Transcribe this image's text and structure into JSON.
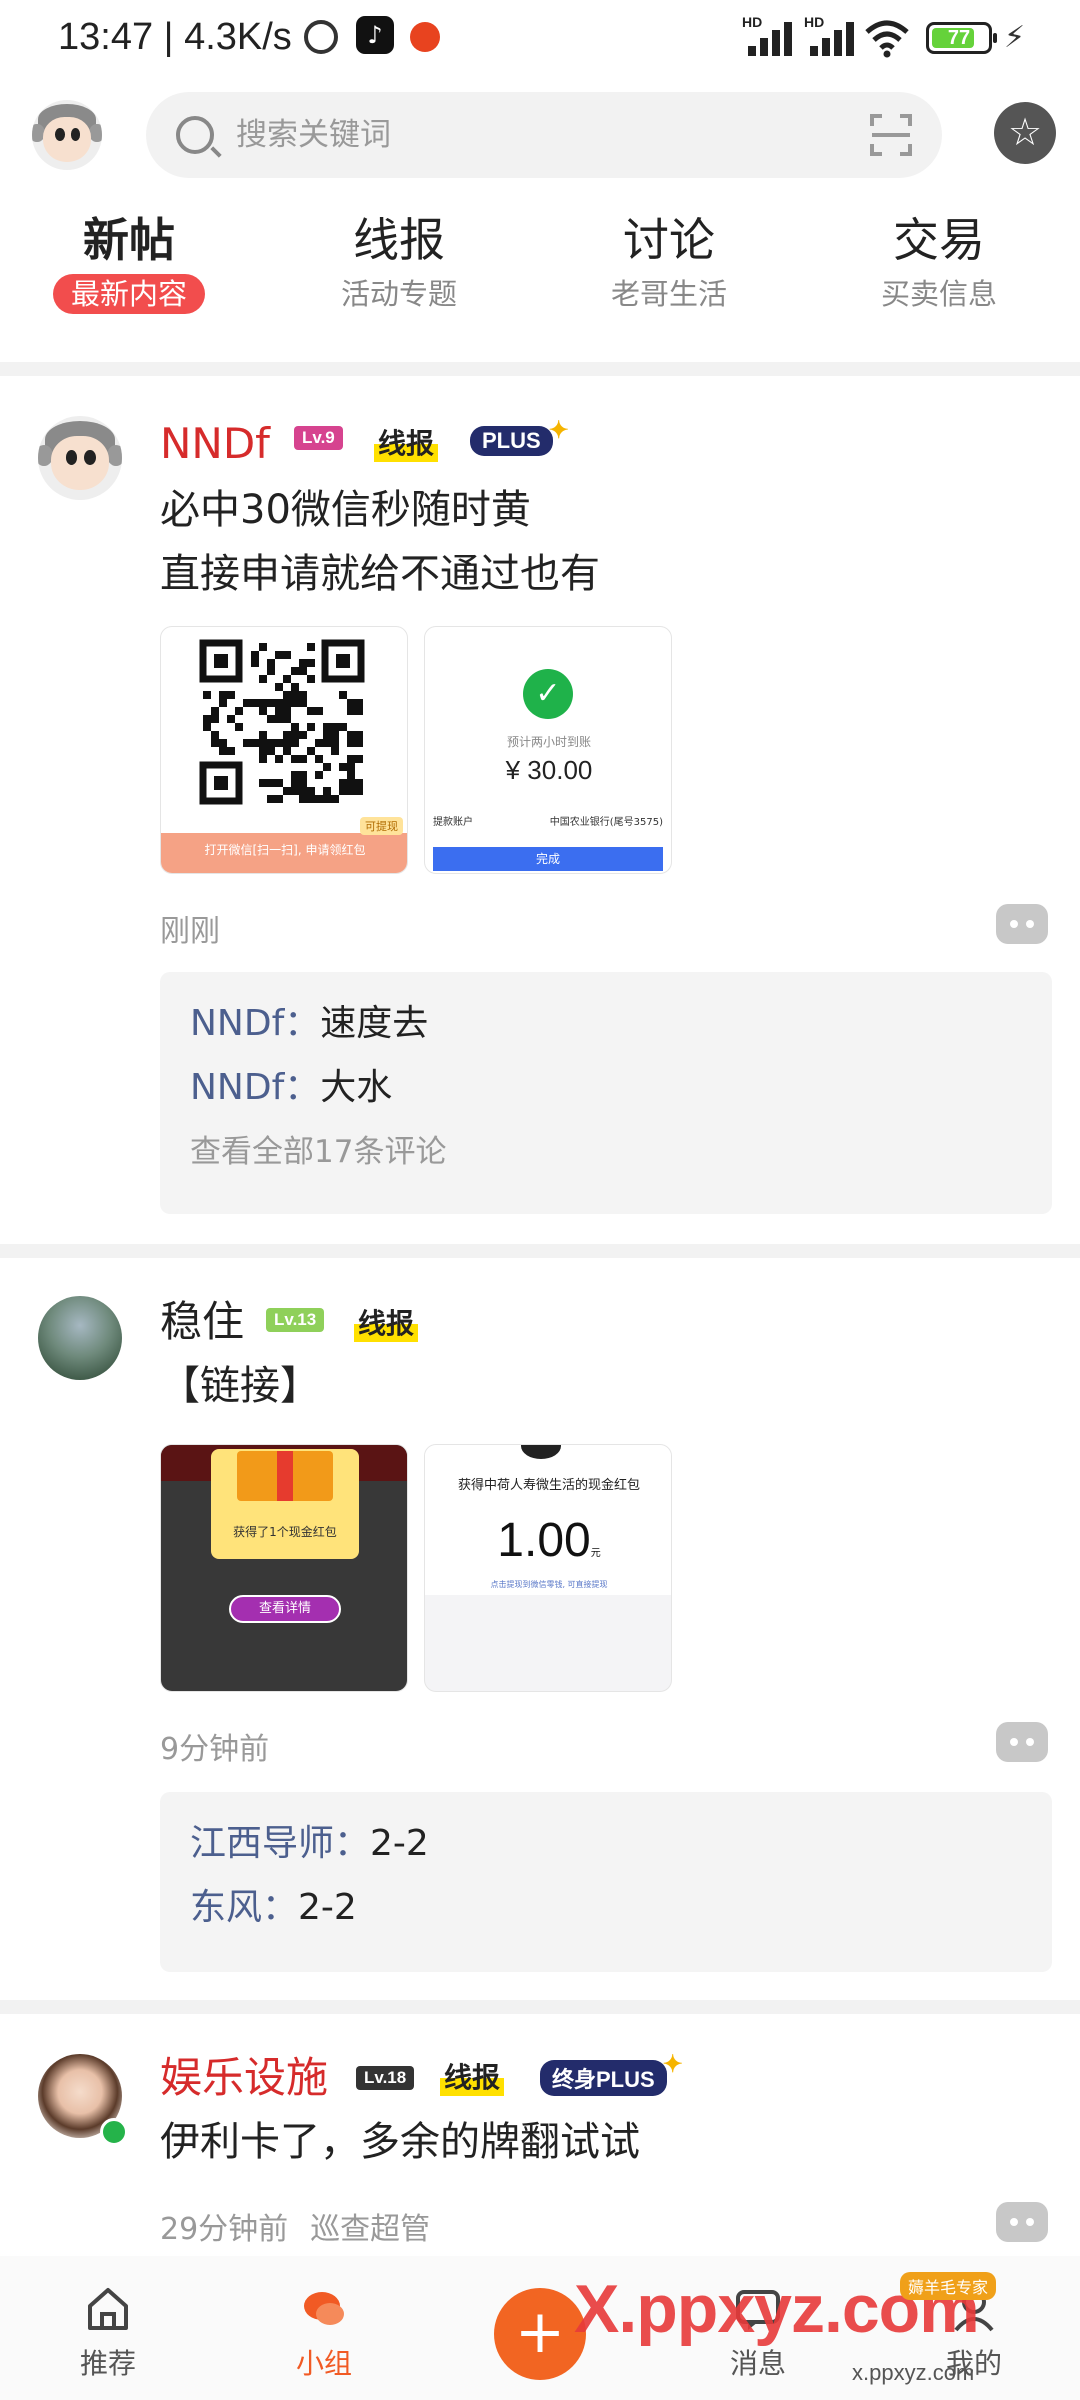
{
  "status_bar": {
    "time": "13:47 | 4.3K/s",
    "battery": "77",
    "battery_level": 0.77,
    "network": [
      "HD",
      "HD"
    ]
  },
  "header": {
    "search_placeholder": "搜索关键词"
  },
  "tabs": [
    {
      "title": "新帖",
      "subtitle": "最新内容",
      "active": true
    },
    {
      "title": "线报",
      "subtitle": "活动专题",
      "active": false
    },
    {
      "title": "讨论",
      "subtitle": "老哥生活",
      "active": false
    },
    {
      "title": "交易",
      "subtitle": "买卖信息",
      "active": false
    }
  ],
  "posts": [
    {
      "username": "NNDf",
      "username_color": "#d62b2b",
      "level": "Lv.9",
      "level_color": "#d6438f",
      "tag": "线报",
      "plus": "PLUS",
      "content": "必中30微信秒随时黄\n直接申请就给不通过也有",
      "images": [
        {
          "type": "qrcode",
          "footer": "打开微信[扫一扫], 申请领红包",
          "corner": "可提现"
        },
        {
          "type": "payment",
          "label": "预计两小时到账",
          "amount": "¥ 30.00",
          "account_label": "提款账户",
          "bank": "中国农业银行(尾号3575)",
          "button": "完成"
        }
      ],
      "time": "刚刚",
      "comments": [
        {
          "name": "NNDf：",
          "text": "速度去"
        },
        {
          "name": "NNDf：",
          "text": "大水"
        }
      ],
      "more": "查看全部17条评论"
    },
    {
      "username": "稳住",
      "username_color": "#222222",
      "level": "Lv.13",
      "level_color": "#8fd05a",
      "tag": "线报",
      "content": "【链接】",
      "images": [
        {
          "type": "redpacket",
          "text": "获得了1个现金红包",
          "button": "查看详情"
        },
        {
          "type": "cash",
          "title": "获得中荷人寿微生活的现金红包",
          "amount": "1.00",
          "unit": "元",
          "note": "点击提现到微信零钱, 可直接提现"
        }
      ],
      "time": "9分钟前",
      "comments": [
        {
          "name": "江西导师：",
          "text": "2-2"
        },
        {
          "name": "东风：",
          "text": "2-2"
        }
      ]
    },
    {
      "username": "娱乐设施",
      "username_color": "#d62b2b",
      "level": "Lv.18",
      "level_color": "#333333",
      "tag": "线报",
      "plus": "终身PLUS",
      "content": "伊利卡了，多余的牌翻试试",
      "time": "29分钟前",
      "time_extra": "巡查超管"
    }
  ],
  "bottom_nav": [
    {
      "label": "推荐",
      "icon": "home-icon",
      "active": false
    },
    {
      "label": "小组",
      "icon": "chat-bubble-icon",
      "active": true
    },
    {
      "label": "消息",
      "icon": "message-icon",
      "active": false
    },
    {
      "label": "我的",
      "icon": "profile-icon",
      "active": false
    }
  ],
  "fab": "+",
  "watermark": {
    "main": "X.ppxyz.com",
    "sub": "x.ppxyz.com",
    "tag": "薅羊毛专家"
  }
}
